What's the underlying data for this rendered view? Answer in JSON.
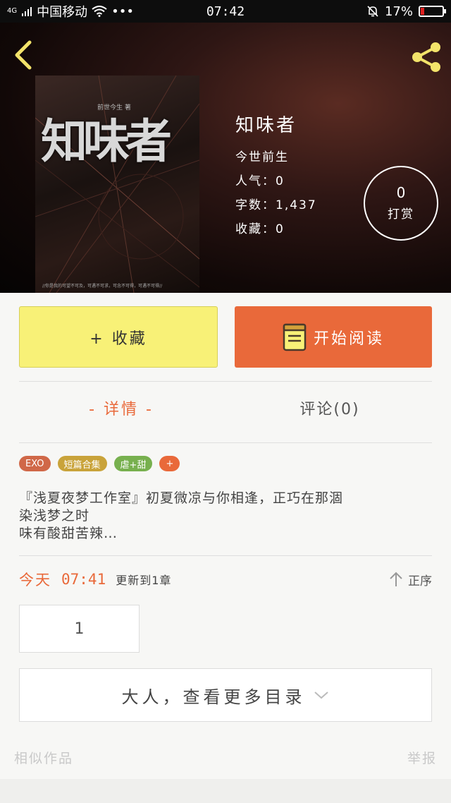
{
  "status_bar": {
    "signal": "4G",
    "carrier": "中国移动",
    "more": "•••",
    "time": "07:42",
    "battery_percent": "17%",
    "battery_level": 0.17
  },
  "book": {
    "cover_title": "知味者",
    "cover_subtitle": "前世今生 著",
    "cover_tagline": "//你是我的可望不可及，可遇不可求，可念不可得，可遇不可得//",
    "title": "知味者",
    "author": "今世前生",
    "popularity": "人气：0",
    "word_count": "字数：1,437",
    "favorites": "收藏：0",
    "reward_count": "0",
    "reward_label": "打赏"
  },
  "actions": {
    "collect_label": "+ 收藏",
    "read_label": "开始阅读"
  },
  "tabs": {
    "detail": "- 详情 -",
    "comments": "评论(0)"
  },
  "tags": [
    {
      "label": "EXO",
      "color": "#d06848"
    },
    {
      "label": "短篇合集",
      "color": "#c9a33a"
    },
    {
      "label": "虐+甜",
      "color": "#77b04e"
    },
    {
      "label": "+",
      "color": "#e9693a"
    }
  ],
  "summary": {
    "line1": "『浅夏夜梦工作室』初夏微凉与你相逢，正巧在那涸",
    "line2": "染浅梦之时",
    "line3": "味有酸甜苦辣…"
  },
  "update": {
    "day": "今天",
    "time": "07:41",
    "text": "更新到1章",
    "sort_label": "正序"
  },
  "chapters": {
    "first": "1",
    "more_label": "大人，查看更多目录"
  },
  "footer": {
    "similar": "相似作品",
    "report": "举报"
  },
  "colors": {
    "accent": "#e9693a",
    "collect_bg": "#f8f177",
    "hero_bg": "#1a0d0b"
  }
}
